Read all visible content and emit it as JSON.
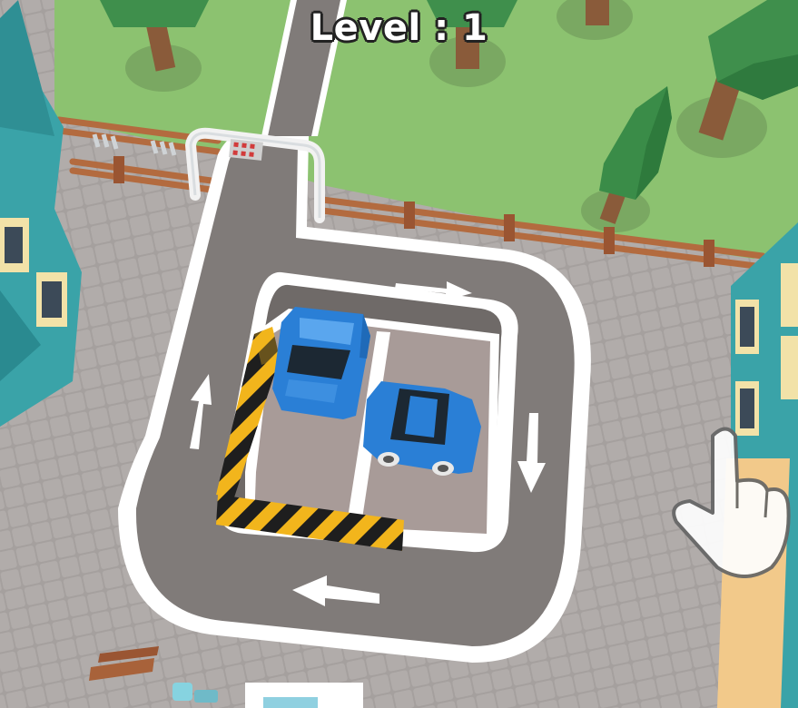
{
  "hud": {
    "level_label": "Level : 1"
  },
  "game": {
    "parked_cars": [
      {
        "id": "car-top-left",
        "color": "#2a7fd6"
      },
      {
        "id": "car-right",
        "color": "#2a7fd6"
      }
    ],
    "road_arrows": [
      "right",
      "down",
      "left",
      "up"
    ],
    "tutorial_hint": "hand-pointer-icon"
  },
  "colors": {
    "grass": "#8cc270",
    "pavement": "#a19c9a",
    "road": "#807b79",
    "road_edge": "#ffffff",
    "car_blue": "#2a7fd6",
    "building_teal": "#3aa3a8",
    "building_cream": "#f2e2a8",
    "barrier_yellow": "#f2b51c",
    "barrier_black": "#1e1e1e",
    "fence": "#b36b3f"
  }
}
